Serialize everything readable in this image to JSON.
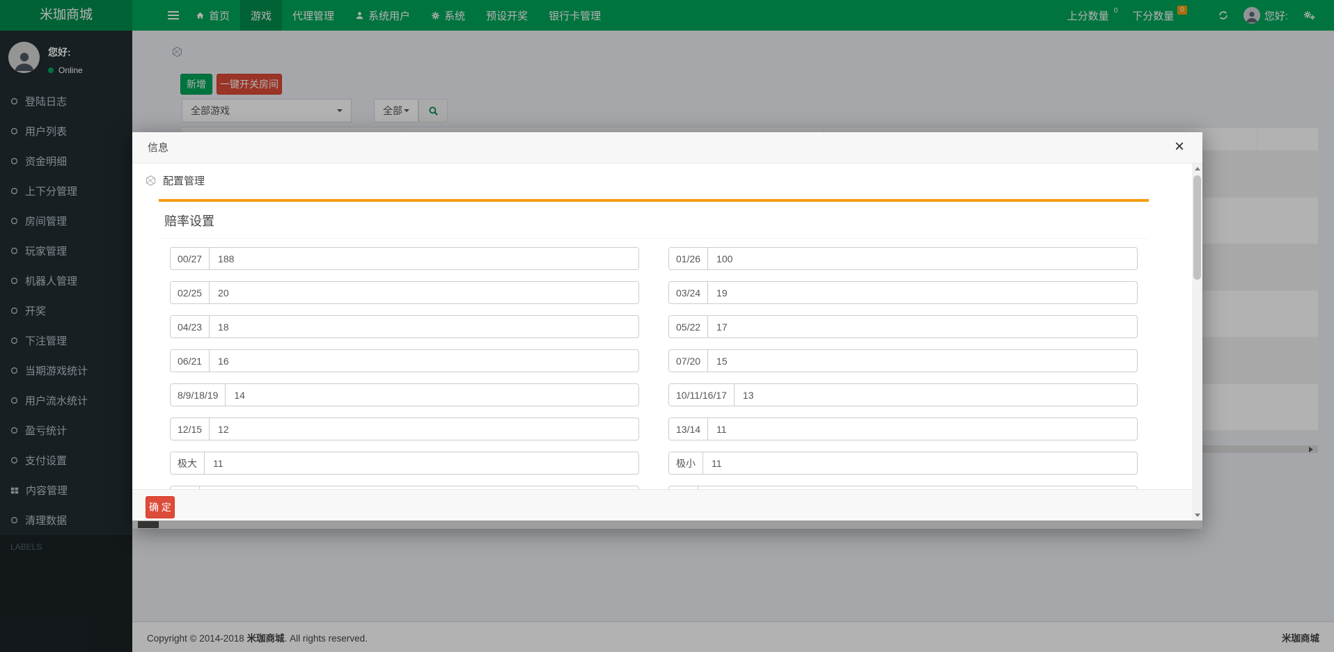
{
  "navbar": {
    "brand": "米珈商城",
    "menu": [
      {
        "label": "首页",
        "icon": "home",
        "active": false
      },
      {
        "label": "游戏",
        "icon": "",
        "active": true
      },
      {
        "label": "代理管理",
        "icon": "",
        "active": false
      },
      {
        "label": "系统用户",
        "icon": "user",
        "active": false
      },
      {
        "label": "系统",
        "icon": "gear",
        "active": false
      },
      {
        "label": "预设开奖",
        "icon": "",
        "active": false
      },
      {
        "label": "银行卡管理",
        "icon": "",
        "active": false
      }
    ],
    "score_up": {
      "label": "上分数量",
      "badge": "0"
    },
    "score_down": {
      "label": "下分数量",
      "badge": "0"
    },
    "greeting": "您好:"
  },
  "sidebar": {
    "greeting": "您好:",
    "status": "Online",
    "menu": [
      {
        "label": "登陆日志",
        "icon": "circle-o"
      },
      {
        "label": "用户列表",
        "icon": "circle-o"
      },
      {
        "label": "资金明细",
        "icon": "circle-o"
      },
      {
        "label": "上下分管理",
        "icon": "circle-o"
      },
      {
        "label": "房间管理",
        "icon": "circle-o"
      },
      {
        "label": "玩家管理",
        "icon": "circle-o"
      },
      {
        "label": "机器人管理",
        "icon": "circle-o"
      },
      {
        "label": "开奖",
        "icon": "circle-o"
      },
      {
        "label": "下注管理",
        "icon": "circle-o"
      },
      {
        "label": "当期游戏统计",
        "icon": "circle-o"
      },
      {
        "label": "用户流水统计",
        "icon": "circle-o"
      },
      {
        "label": "盈亏统计",
        "icon": "circle-o"
      },
      {
        "label": "支付设置",
        "icon": "circle-o"
      },
      {
        "label": "内容管理",
        "icon": "th"
      },
      {
        "label": "清理数据",
        "icon": "circle-o"
      }
    ],
    "section_header": "LABELS"
  },
  "content": {
    "add_button": "新增",
    "toggle_button": "一键开关房间",
    "game_filter": "全部游戏",
    "status_filter": "全部"
  },
  "modal": {
    "title": "信息",
    "close": "×",
    "breadcrumb": "配置管理",
    "section_title": "赔率设置",
    "confirm_button": "确 定",
    "odds": [
      {
        "label": "00/27",
        "value": "188"
      },
      {
        "label": "01/26",
        "value": "100"
      },
      {
        "label": "02/25",
        "value": "20"
      },
      {
        "label": "03/24",
        "value": "19"
      },
      {
        "label": "04/23",
        "value": "18"
      },
      {
        "label": "05/22",
        "value": "17"
      },
      {
        "label": "06/21",
        "value": "16"
      },
      {
        "label": "07/20",
        "value": "15"
      },
      {
        "label": "8/9/18/19",
        "value": "14"
      },
      {
        "label": "10/11/16/17",
        "value": "13"
      },
      {
        "label": "12/15",
        "value": "12"
      },
      {
        "label": "13/14",
        "value": "11"
      },
      {
        "label": "极大",
        "value": "11"
      },
      {
        "label": "极小",
        "value": "11"
      }
    ]
  },
  "footer": {
    "copyright": "Copyright © 2014-2018",
    "brand": "米珈商城",
    "rights": ". All rights reserved.",
    "right_brand": "米珈商城"
  },
  "colors": {
    "navbar_green": "#00a65a",
    "brand_green": "#008d4c",
    "sidebar_dark": "#222d32",
    "accent_orange": "#f39c12",
    "danger_red": "#dd4b39",
    "badge_orange": "#f39c12"
  }
}
